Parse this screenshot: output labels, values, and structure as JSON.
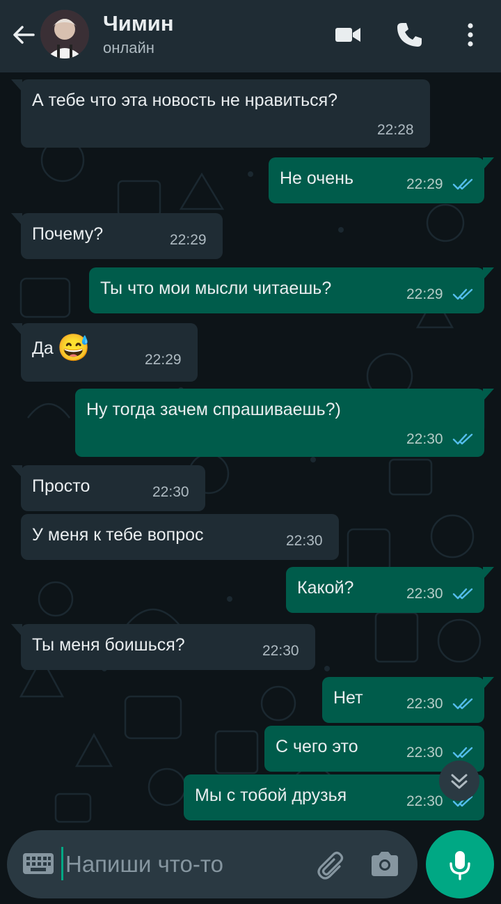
{
  "header": {
    "contact_name": "Чимин",
    "status": "онлайн"
  },
  "icons": {
    "back": "arrow-left",
    "video": "video-camera",
    "call": "phone",
    "menu": "more-vertical",
    "scroll": "chevrons-down",
    "keyboard": "keyboard",
    "attach": "paperclip",
    "camera": "camera",
    "mic": "microphone",
    "read_ticks": "double-check"
  },
  "colors": {
    "header_bg": "#1f2c34",
    "chat_bg": "#0d1418",
    "incoming_bubble": "#1f2c34",
    "outgoing_bubble": "#005c4b",
    "read_tick": "#53bdeb",
    "accent": "#00a884"
  },
  "messages": [
    {
      "dir": "in",
      "text": "А тебе что эта новость не нравиться?",
      "time": "22:28"
    },
    {
      "dir": "out",
      "text": "Не очень",
      "time": "22:29",
      "read": true
    },
    {
      "dir": "in",
      "text": "Почему?",
      "time": "22:29"
    },
    {
      "dir": "out",
      "text": "Ты что мои мысли читаешь?",
      "time": "22:29",
      "read": true
    },
    {
      "dir": "in",
      "text": "Да",
      "emoji": "😅",
      "time": "22:29"
    },
    {
      "dir": "out",
      "text": "Ну тогда зачем спрашиваешь?)",
      "time": "22:30",
      "read": true
    },
    {
      "dir": "in",
      "text": "Просто",
      "time": "22:30"
    },
    {
      "dir": "in",
      "text": "У меня к тебе вопрос",
      "time": "22:30"
    },
    {
      "dir": "out",
      "text": "Какой?",
      "time": "22:30",
      "read": true
    },
    {
      "dir": "in",
      "text": "Ты меня боишься?",
      "time": "22:30"
    },
    {
      "dir": "out",
      "text": "Нет",
      "time": "22:30",
      "read": true
    },
    {
      "dir": "out",
      "text": "С чего это",
      "time": "22:30",
      "read": true
    },
    {
      "dir": "out",
      "text": "Мы с тобой друзья",
      "time": "22:30",
      "read": true
    }
  ],
  "composer": {
    "placeholder": "Напиши что-то",
    "value": ""
  }
}
